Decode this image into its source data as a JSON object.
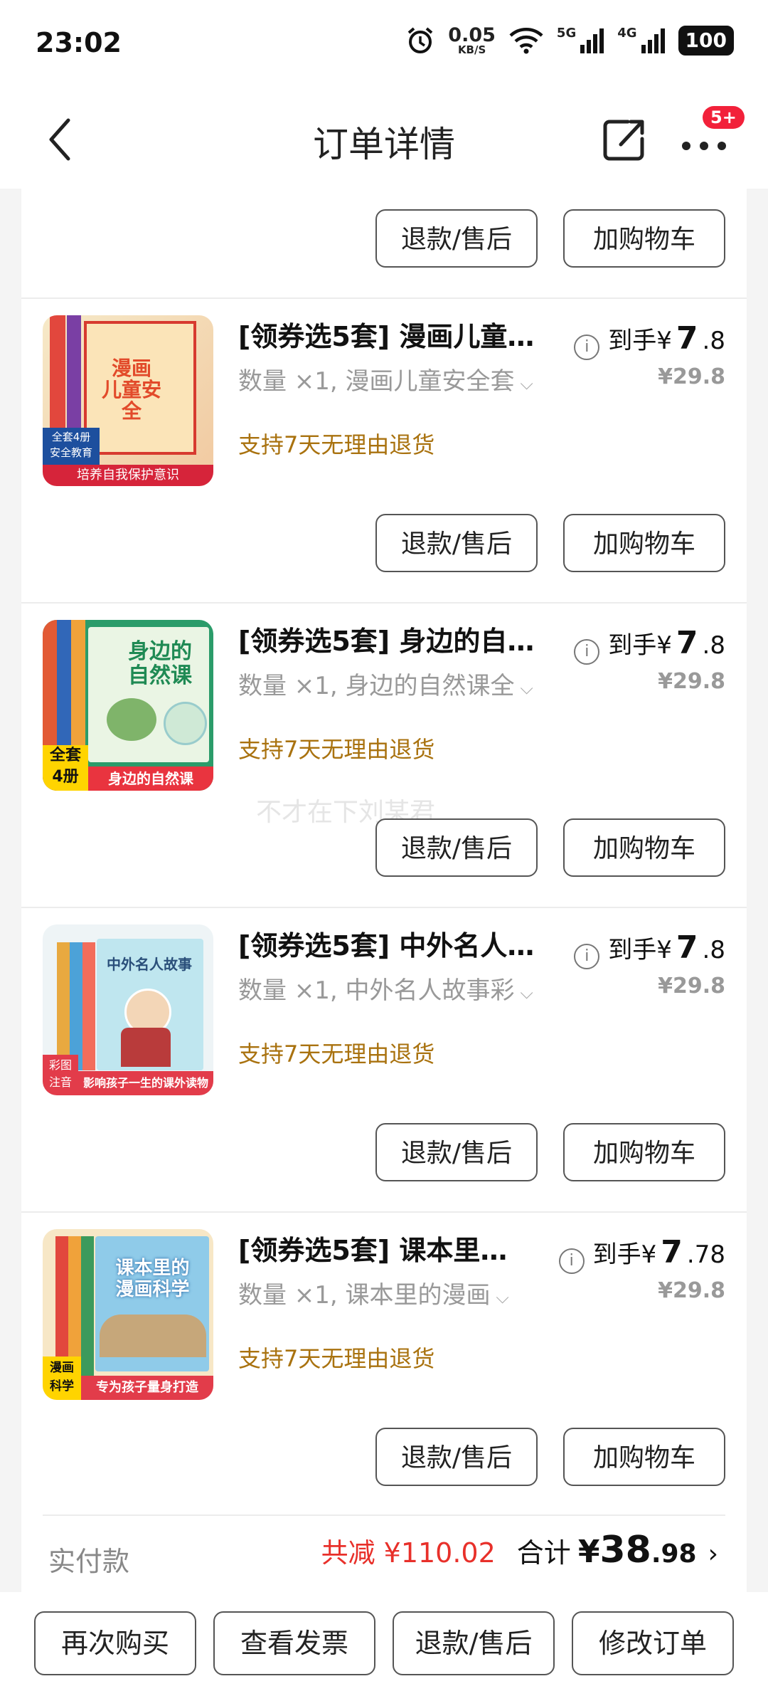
{
  "status": {
    "time": "23:02",
    "speed": "0.05",
    "speed_unit": "KB/S",
    "sig1": "5G",
    "sig2": "4G",
    "battery": "100"
  },
  "nav": {
    "title": "订单详情",
    "badge": "5+"
  },
  "top_actions": {
    "refund": "退款/售后",
    "cart": "加购物车"
  },
  "items": [
    {
      "title": "[领券选5套] 漫画儿童…",
      "spec": "数量 ×1, 漫画儿童安全套",
      "policy": "支持7天无理由退货",
      "price_prefix": "到手¥",
      "price_int": "7",
      "price_dec": ".8",
      "orig": "¥29.8",
      "refund": "退款/售后",
      "cart": "加购物车",
      "thumb": {
        "main": "漫画\n儿童安全",
        "banner": "培养自我保护意识",
        "corner": "全套4册\n安全教育"
      }
    },
    {
      "title": "[领券选5套] 身边的自…",
      "spec": "数量 ×1, 身边的自然课全",
      "policy": "支持7天无理由退货",
      "price_prefix": "到手¥",
      "price_int": "7",
      "price_dec": ".8",
      "orig": "¥29.8",
      "refund": "退款/售后",
      "cart": "加购物车",
      "thumb": {
        "main": "身边的\n自然课",
        "banner": "身边的自然课",
        "corner": "全套\n4册"
      }
    },
    {
      "title": "[领券选5套] 中外名人…",
      "spec": "数量 ×1, 中外名人故事彩",
      "policy": "支持7天无理由退货",
      "price_prefix": "到手¥",
      "price_int": "7",
      "price_dec": ".8",
      "orig": "¥29.8",
      "refund": "退款/售后",
      "cart": "加购物车",
      "thumb": {
        "main": "中外名人故事",
        "banner": "影响孩子一生的课外读物",
        "corner": "彩图\n注音"
      }
    },
    {
      "title": "[领券选5套] 课本里…",
      "spec": "数量 ×1, 课本里的漫画",
      "policy": "支持7天无理由退货",
      "price_prefix": "到手¥",
      "price_int": "7",
      "price_dec": ".78",
      "orig": "¥29.8",
      "refund": "退款/售后",
      "cart": "加购物车",
      "thumb": {
        "main": "课本里的\n漫画科学",
        "banner": "专为孩子量身打造",
        "corner": "漫画\n科学"
      }
    }
  ],
  "watermark": "不才在下刘某君",
  "summary": {
    "label": "实付款",
    "discount": "共减 ¥110.02",
    "total_label": "合计",
    "total_symbol": "¥",
    "total_int": "38",
    "total_dec": ".98"
  },
  "bottom": {
    "b1": "再次购买",
    "b2": "查看发票",
    "b3": "退款/售后",
    "b4": "修改订单"
  }
}
